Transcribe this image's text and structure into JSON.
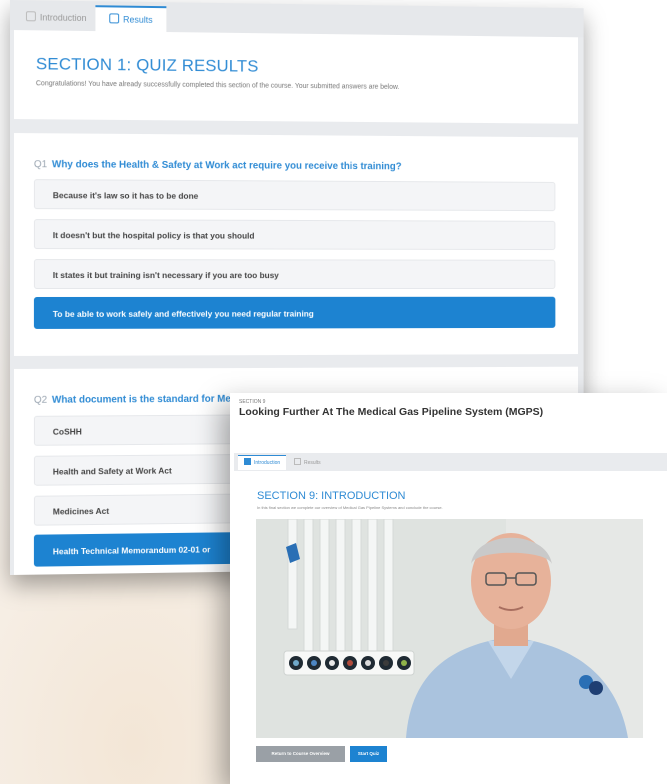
{
  "quiz_page": {
    "tabs": [
      {
        "label": "Introduction"
      },
      {
        "label": "Results"
      }
    ],
    "heading": "SECTION 1: QUIZ RESULTS",
    "subheading": "Congratulations! You have already successfully completed this section of the course. Your submitted answers are below.",
    "questions": [
      {
        "number": "Q1",
        "text": "Why does the Health & Safety at Work act require you receive this training?",
        "answers": [
          {
            "text": "Because it's law so it has to be done",
            "selected": false
          },
          {
            "text": "It doesn't but the hospital policy is that you should",
            "selected": false
          },
          {
            "text": "It states it but training isn't necessary if you are too busy",
            "selected": false
          },
          {
            "text": "To be able to work safely and effectively you need regular training",
            "selected": true
          }
        ]
      },
      {
        "number": "Q2",
        "text": "What document is the standard for Medical Gas Systems in the UK?",
        "answers": [
          {
            "text": "CoSHH",
            "selected": false
          },
          {
            "text": "Health and Safety at Work Act",
            "selected": false
          },
          {
            "text": "Medicines Act",
            "selected": false
          },
          {
            "text": "Health Technical Memorandum 02-01 or",
            "selected": true
          }
        ]
      }
    ]
  },
  "section_page": {
    "eyebrow": "SECTION 9",
    "title": "Looking Further At The Medical Gas Pipeline System (MGPS)",
    "tabs": [
      {
        "label": "Introduction"
      },
      {
        "label": "Results"
      }
    ],
    "heading": "SECTION 9: INTRODUCTION",
    "subheading": "In this final section we complete our overview of Medical Gas Pipeline Systems and conclude the course.",
    "video": {
      "icon": "video-presenter"
    },
    "buttons": {
      "return": "Return to Course Overview",
      "start": "Start Quiz"
    }
  },
  "colors": {
    "accent": "#2f8bd4",
    "selected": "#1d83d1",
    "grey_button": "#9aa0a6"
  }
}
